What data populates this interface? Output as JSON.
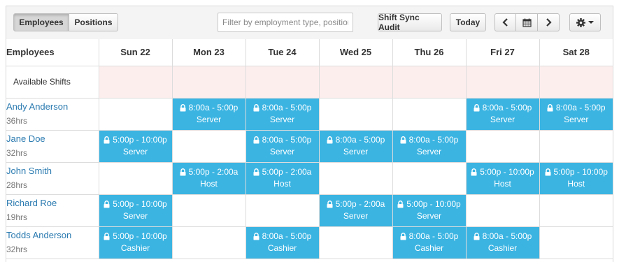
{
  "toolbar": {
    "view_tabs": [
      "Employees",
      "Positions"
    ],
    "filter_placeholder": "Filter by employment type, position",
    "audit_label": "Shift Sync Audit",
    "today_label": "Today"
  },
  "grid": {
    "first_column_header": "Employees",
    "days": [
      "Sun 22",
      "Mon 23",
      "Tue 24",
      "Wed 25",
      "Thu 26",
      "Fri 27",
      "Sat 28"
    ],
    "available_shifts_label": "Available Shifts",
    "employees": [
      {
        "name": "Andy Anderson",
        "hours": "36hrs",
        "shifts": [
          null,
          {
            "time": "8:00a - 5:00p",
            "position": "Server"
          },
          {
            "time": "8:00a - 5:00p",
            "position": "Server"
          },
          null,
          null,
          {
            "time": "8:00a - 5:00p",
            "position": "Server"
          },
          {
            "time": "8:00a - 5:00p",
            "position": "Server"
          }
        ]
      },
      {
        "name": "Jane Doe",
        "hours": "32hrs",
        "shifts": [
          {
            "time": "5:00p - 10:00p",
            "position": "Server"
          },
          null,
          {
            "time": "8:00a - 5:00p",
            "position": "Server"
          },
          {
            "time": "8:00a - 5:00p",
            "position": "Server"
          },
          {
            "time": "8:00a - 5:00p",
            "position": "Server"
          },
          null,
          null
        ]
      },
      {
        "name": "John Smith",
        "hours": "28hrs",
        "shifts": [
          null,
          {
            "time": "5:00p - 2:00a",
            "position": "Host"
          },
          {
            "time": "5:00p - 2:00a",
            "position": "Host"
          },
          null,
          null,
          {
            "time": "5:00p - 10:00p",
            "position": "Host"
          },
          {
            "time": "5:00p - 10:00p",
            "position": "Host"
          }
        ]
      },
      {
        "name": "Richard Roe",
        "hours": "19hrs",
        "shifts": [
          {
            "time": "5:00p - 10:00p",
            "position": "Server"
          },
          null,
          null,
          {
            "time": "5:00p - 2:00a",
            "position": "Server"
          },
          {
            "time": "5:00p - 10:00p",
            "position": "Server"
          },
          null,
          null
        ]
      },
      {
        "name": "Todds Anderson",
        "hours": "32hrs",
        "shifts": [
          {
            "time": "5:00p - 10:00p",
            "position": "Cashier"
          },
          null,
          {
            "time": "8:00a - 5:00p",
            "position": "Cashier"
          },
          null,
          {
            "time": "8:00a - 5:00p",
            "position": "Cashier"
          },
          {
            "time": "8:00a - 5:00p",
            "position": "Cashier"
          },
          null
        ]
      }
    ]
  },
  "colors": {
    "shift_fill": "#3bb4e2",
    "available_fill": "#fdeeee",
    "employee_link": "#2a7ab0"
  }
}
